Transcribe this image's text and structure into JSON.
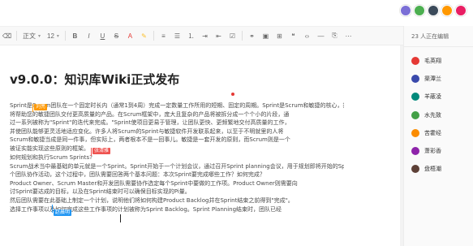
{
  "header": {
    "avatars": [
      {
        "color": "#7b6fd6"
      },
      {
        "color": "#4caf50"
      },
      {
        "color": "#3b4a5a"
      },
      {
        "color": "#ff9800"
      },
      {
        "color": "#e91e63"
      }
    ]
  },
  "toolbar": {
    "items": [
      {
        "type": "icon",
        "icon": "eraser-icon",
        "glyph": "⌫"
      },
      {
        "type": "sep"
      },
      {
        "type": "select",
        "name": "paragraph-style-select",
        "label": "正文"
      },
      {
        "type": "select",
        "name": "font-size-select",
        "label": "12"
      },
      {
        "type": "sep"
      },
      {
        "type": "icon",
        "icon": "bold-icon",
        "glyph": "B"
      },
      {
        "type": "icon",
        "icon": "italic-icon",
        "glyph": "I"
      },
      {
        "type": "icon",
        "icon": "underline-icon",
        "glyph": "U"
      },
      {
        "type": "icon",
        "icon": "strikethrough-icon",
        "glyph": "S"
      },
      {
        "type": "icon",
        "icon": "font-color-icon",
        "glyph": "A"
      },
      {
        "type": "icon",
        "icon": "highlight-icon",
        "glyph": "✎"
      },
      {
        "type": "sep"
      },
      {
        "type": "icon",
        "icon": "align-left-icon",
        "glyph": "≡"
      },
      {
        "type": "icon",
        "icon": "bullet-list-icon",
        "glyph": "☰"
      },
      {
        "type": "icon",
        "icon": "numbered-list-icon",
        "glyph": "⒈"
      },
      {
        "type": "icon",
        "icon": "indent-icon",
        "glyph": "⇥"
      },
      {
        "type": "icon",
        "icon": "outdent-icon",
        "glyph": "⇤"
      },
      {
        "type": "icon",
        "icon": "checklist-icon",
        "glyph": "☑"
      },
      {
        "type": "sep"
      },
      {
        "type": "icon",
        "icon": "link-icon",
        "glyph": "⚭"
      },
      {
        "type": "icon",
        "icon": "image-icon",
        "glyph": "▣"
      },
      {
        "type": "icon",
        "icon": "table-icon",
        "glyph": "⊞"
      },
      {
        "type": "icon",
        "icon": "quote-icon",
        "glyph": "❝"
      },
      {
        "type": "icon",
        "icon": "code-icon",
        "glyph": "‹›"
      },
      {
        "type": "icon",
        "icon": "divider-icon",
        "glyph": "—"
      },
      {
        "type": "icon",
        "icon": "attachment-icon",
        "glyph": "⎘"
      },
      {
        "type": "icon",
        "icon": "more-icon",
        "glyph": "⋯"
      }
    ]
  },
  "document": {
    "title": "v9.0.0：知识库Wiki正式发布",
    "paragraphs": [
      {
        "name": "para-sprint-intro",
        "lines": [
          "Sprint是Scrum团队在一个固定时长内（通常1到4周）完成一定数量工作所用的短期、固定的周期。Sprint是Scrum和敏捷的核心，找到正确的周期",
          "将帮助您的敏捷团队交付更高质量的产品。在Scrum框架中，庞大且复杂的产品将被拆分成一个个小的片段，通",
          "过一系列被称为\"Sprint\"的迭代来完成。\"Sprint使项目更易于管理，让团队更快、更频繁地交付高质量的工作，",
          "并使团队能够更灵活地适应变化。许多人将Scrum的Sprint与敏捷软件开发联系起来，以至于不明就里的人将",
          "Scrum和敏捷当成是同一件事，但实际上，两者根本不是一回事儿。敏捷是一套开发的原则，而Scrum则是一个",
          "被证实能实现这些原则的框架。"
        ]
      },
      {
        "name": "para-how-to-plan",
        "lines": [
          "如何规划和执行Scrum Sprints?",
          "Scrum战术当中最基础的单元就是一个Sprint。Sprint开始于一个计划会议，通过召开Sprint planning会议，用于规划即将开始的Sprint。Sprint Planning是一",
          "个团队协作活动，这个过程中，团队需要回答两个基本问题：本次Sprint要完成哪些工作？如何完成？",
          "Product Owner、Scrum Master和开发团队需要协作选定每个Sprint中要做的工作项。Product Owner则需要向",
          "讨Sprint要达成的目标，以及在Sprint结束时可以确保目标实现的Pi量。",
          "然后团队需要在此基础上制定一个计划，说明他们将如何构建Product Backlog并在Sprint结束之前得到\"完成\"。",
          "选择工作事项以及如何完成这些工作事项的计划被称为Sprint Backlog。Sprint Planning结束时，团队已经"
        ]
      }
    ],
    "collab_tags": [
      {
        "label": "刘亮",
        "color": "#ff9800"
      },
      {
        "label": "张清雅",
        "color": "#ef5350"
      },
      {
        "label": "赵晨明",
        "color": "#2196f3"
      }
    ]
  },
  "sidebar": {
    "header": "23 人正在编辑",
    "users": [
      {
        "name": "毛英翔",
        "color": "#e53935"
      },
      {
        "name": "渠潭兰",
        "color": "#3949ab"
      },
      {
        "name": "羊蔽凌",
        "color": "#00897b"
      },
      {
        "name": "水先致",
        "color": "#43a047"
      },
      {
        "name": "苦霍经",
        "color": "#fb8c00"
      },
      {
        "name": "萧彩香",
        "color": "#8e24aa"
      },
      {
        "name": "盘梧潮",
        "color": "#5d4037"
      }
    ]
  }
}
